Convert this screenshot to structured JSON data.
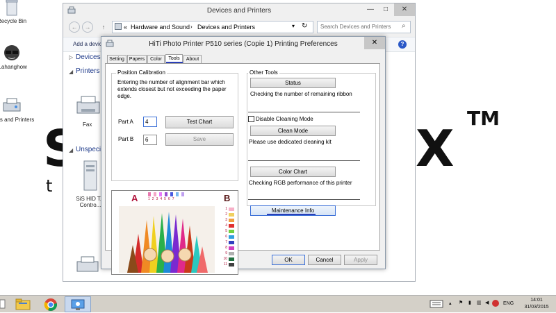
{
  "desktop": {
    "icons": [
      {
        "label": "Recycle Bin"
      },
      {
        "label": "...ahanghow"
      },
      {
        "label": "...ces and Printers"
      }
    ],
    "wallpaper_text_left": "S",
    "wallpaper_text_t": "t",
    "wallpaper_text_right": "X",
    "wallpaper_tm": "TM"
  },
  "explorer": {
    "title": "Devices and Printers",
    "breadcrumb": [
      "«",
      "Hardware and Sound",
      "Devices and Printers"
    ],
    "search_placeholder": "Search Devices and Printers",
    "command_add_device": "Add a device",
    "groups": {
      "devices": "Devices",
      "printers": "Printers",
      "unspecified": "Unspecif"
    },
    "devices": [
      {
        "label": "Fax"
      },
      {
        "label": "SiS HID T... Contro..."
      }
    ]
  },
  "dialog": {
    "title": "HiTi Photo Printer P510 series (Copie 1) Printing Preferences",
    "tabs": [
      "Setting",
      "Papers",
      "Color",
      "Tools",
      "About"
    ],
    "active_tab": "Tools",
    "position_calibration": {
      "legend": "Position Calibration",
      "instructions": "Entering the number of alignment bar which extends closest but not exceeding the paper edge.",
      "part_a_label": "Part A",
      "part_a_value": "4",
      "part_b_label": "Part B",
      "part_b_value": "6",
      "test_chart_button": "Test Chart",
      "save_button": "Save",
      "chart_label_a": "A",
      "chart_label_b": "B",
      "scale_numbers": [
        "1",
        "2",
        "3",
        "4",
        "5",
        "6",
        "7",
        "8",
        "9",
        "10",
        "11"
      ]
    },
    "other_tools": {
      "legend": "Other Tools",
      "status_button": "Status",
      "status_desc": "Checking the number of remaining ribbon",
      "disable_cleaning_label": "Disable Cleaning Mode",
      "disable_cleaning_checked": false,
      "clean_mode_button": "Clean Mode",
      "clean_mode_desc": "Please use dedicated cleaning kit",
      "color_chart_button": "Color Chart",
      "color_chart_desc": "Checking RGB performance of this printer",
      "maintenance_button": "Maintenance Info"
    },
    "ok_button": "OK",
    "cancel_button": "Cancel",
    "apply_button": "Apply"
  },
  "taskbar": {
    "language": "ENG",
    "time": "14:01",
    "date": "31/03/2015"
  },
  "colors": {
    "accent_blue": "#2a3fb7",
    "label_a": "#b0123a",
    "label_b": "#5a1a1a"
  }
}
